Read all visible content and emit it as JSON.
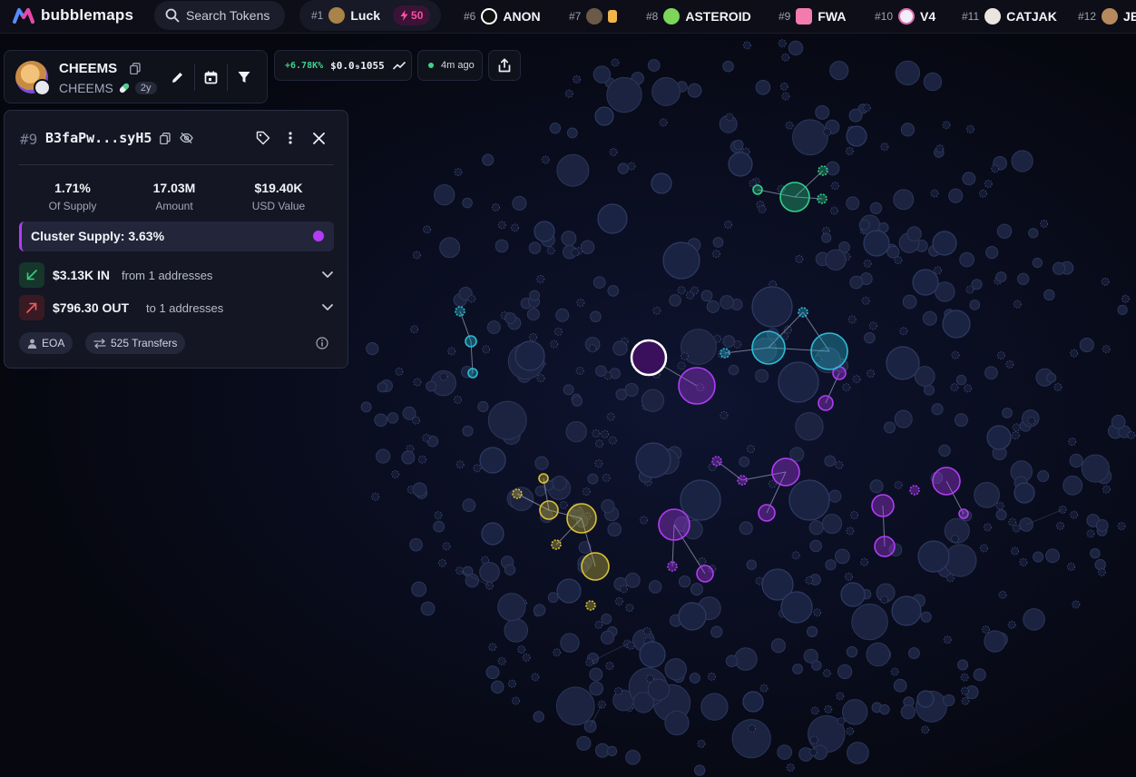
{
  "app": {
    "name": "bubblemaps"
  },
  "search": {
    "label": "Search Tokens"
  },
  "trending": [
    {
      "rank": "#1",
      "name": "Luck",
      "boost": "50",
      "avatar_color": "#a88449"
    },
    {
      "rank": "#6",
      "name": "ANON",
      "avatar_color": "#ffffff"
    },
    {
      "rank": "#7",
      "name": "",
      "avatar_color": "#6b5a48"
    },
    {
      "rank": "#8",
      "name": "ASTEROID",
      "avatar_color": "#7cd65a"
    },
    {
      "rank": "#9",
      "name": "FWA",
      "avatar_color": "#f27bb0"
    },
    {
      "rank": "#10",
      "name": "V4",
      "avatar_color": "#f0eef8"
    },
    {
      "rank": "#11",
      "name": "CATJAK",
      "avatar_color": "#e9e6df"
    },
    {
      "rank": "#12",
      "name": "JE",
      "avatar_color": "#b68a5e"
    }
  ],
  "token": {
    "name": "CHEEMS",
    "symbol": "CHEEMS",
    "age": "2y",
    "price_change": "+6.78K%",
    "price": "$0.0₉1055",
    "updated": "4m ago"
  },
  "wallet": {
    "rank": "#9",
    "address": "B3faPw...syH5",
    "stats": [
      {
        "value": "1.71%",
        "label": "Of Supply"
      },
      {
        "value": "17.03M",
        "label": "Amount"
      },
      {
        "value": "$19.40K",
        "label": "USD Value"
      }
    ],
    "cluster_supply": "Cluster Supply: 3.63%",
    "inflow": {
      "amount": "$3.13K IN",
      "desc": "from 1 addresses"
    },
    "outflow": {
      "amount": "$796.30 OUT",
      "desc": "to 1 addresses"
    },
    "type": "EOA",
    "transfers": "525 Transfers"
  },
  "colors": {
    "cluster_purple": "#b13cf5",
    "cluster_cyan": "#2bbcd4",
    "cluster_green": "#2fd18a",
    "cluster_yellow": "#d8c238",
    "bubble_default": "#1b2340"
  }
}
